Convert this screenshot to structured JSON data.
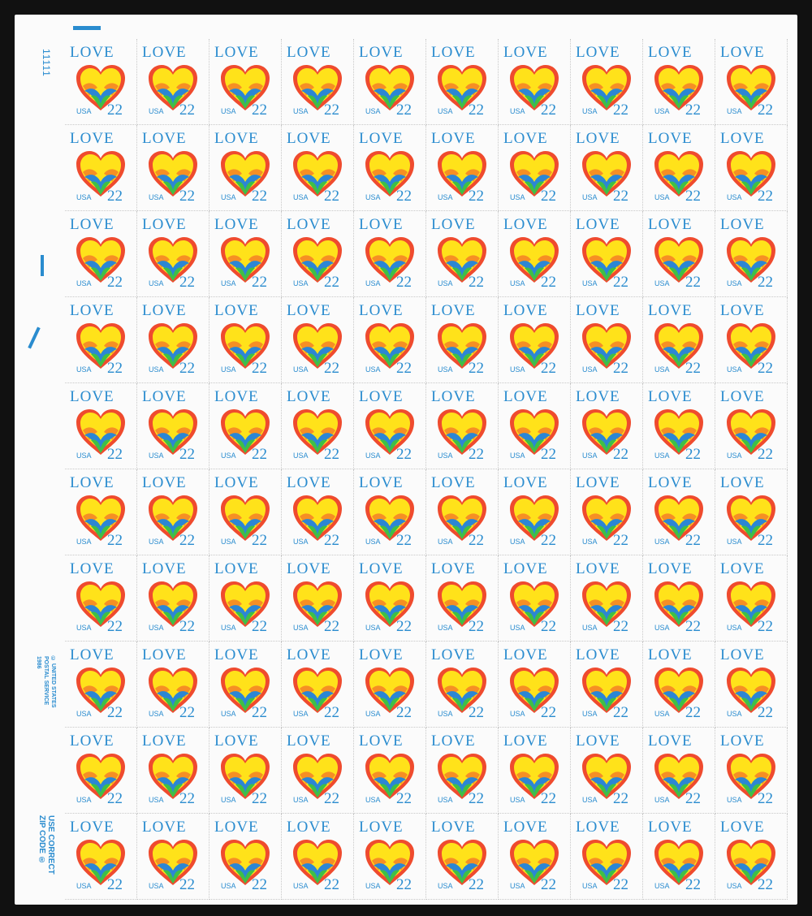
{
  "sheet": {
    "margin_plate_number": "11111",
    "copyright": "© UNITED STATES POSTAL SERVICE 1986",
    "zip_inscription": "USE CORRECT ZIP CODE ®",
    "rows": 10,
    "columns": 10
  },
  "stamp": {
    "title": "LOVE",
    "country": "USA",
    "denomination": "22",
    "colors": {
      "text": "#2a8ccf",
      "heart_red": "#ef4b2e",
      "yellow": "#ffe21a",
      "blue": "#2c86d4",
      "green": "#3fbf47"
    }
  }
}
